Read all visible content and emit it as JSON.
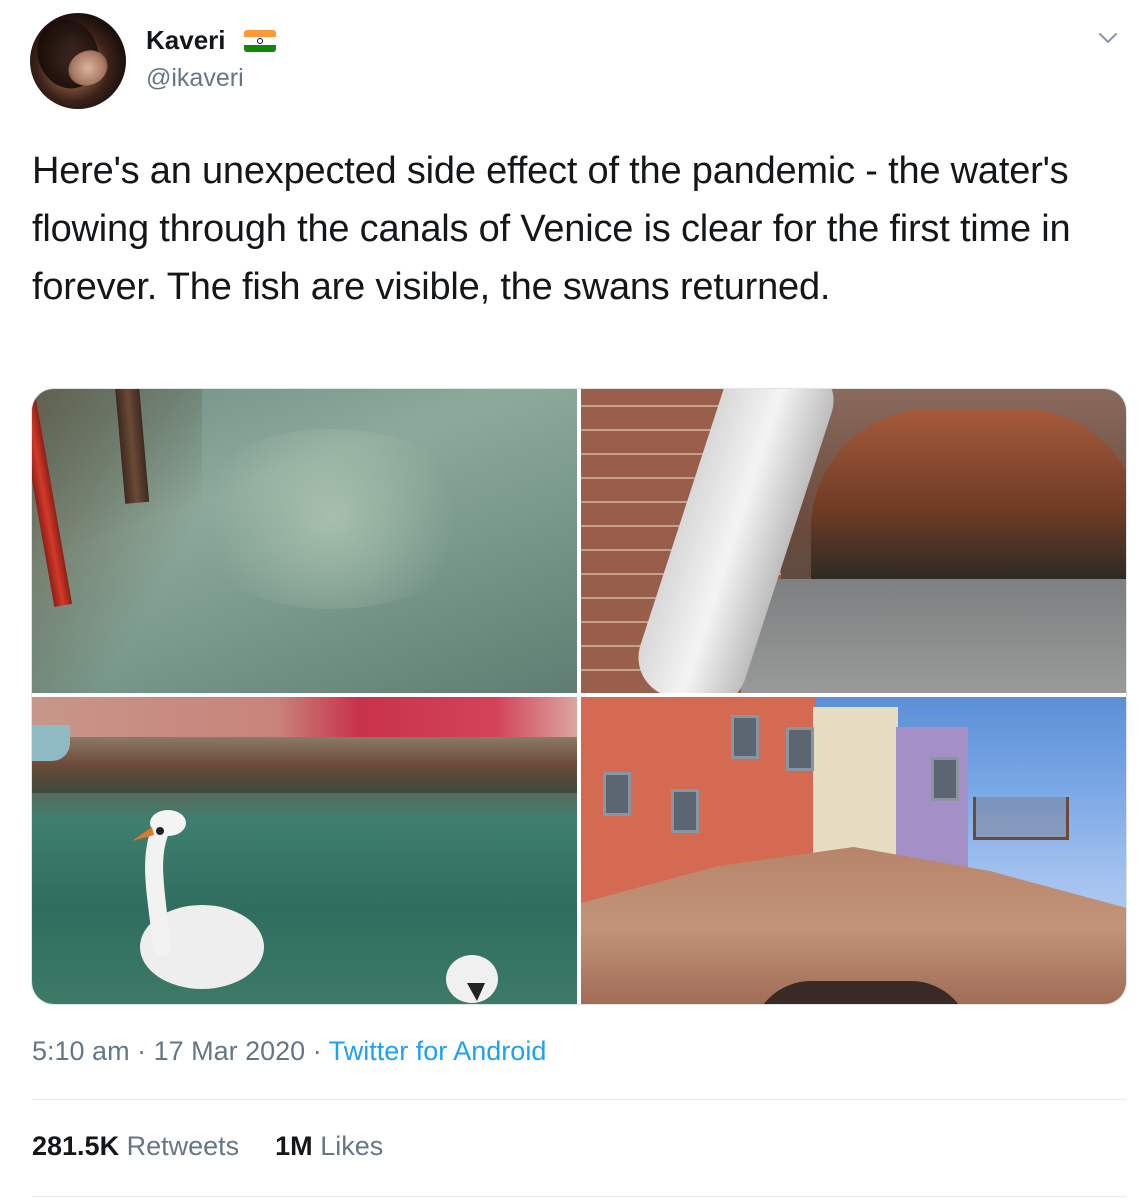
{
  "author": {
    "display_name": "Kaveri",
    "flag": "india-flag-icon",
    "handle": "@ikaveri"
  },
  "tweet": {
    "text": "Here's an unexpected side effect of the pandemic - the water's flowing through the canals of Venice is clear for the first time in forever. The fish are visible, the swans returned."
  },
  "media": {
    "photos": [
      {
        "name": "fish-in-canal-photo"
      },
      {
        "name": "bridge-arch-photo"
      },
      {
        "name": "swans-in-canal-photo"
      },
      {
        "name": "colorful-buildings-bridge-photo"
      }
    ]
  },
  "meta": {
    "time": "5:10 am",
    "sep1": "·",
    "date": "17 Mar 2020",
    "sep2": "·",
    "source": "Twitter for Android"
  },
  "stats": {
    "retweets_count": "281.5K",
    "retweets_label": "Retweets",
    "likes_count": "1M",
    "likes_label": "Likes"
  },
  "colors": {
    "link": "#1da1f2",
    "secondary_text": "#657786",
    "primary_text": "#14171a"
  }
}
